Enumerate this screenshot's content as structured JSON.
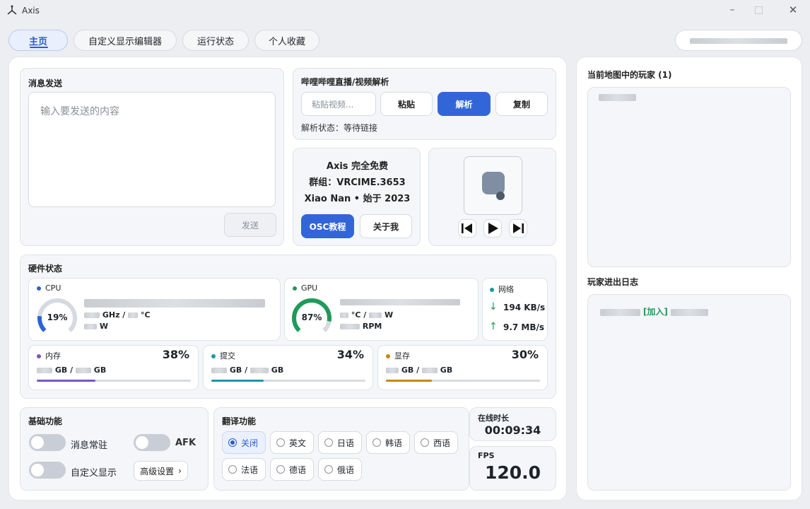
{
  "window": {
    "title": "Axis"
  },
  "tabs": [
    {
      "label": "主页"
    },
    {
      "label": "自定义显示编辑器"
    },
    {
      "label": "运行状态"
    },
    {
      "label": "个人收藏"
    }
  ],
  "message": {
    "title": "消息发送",
    "placeholder": "输入要发送的内容",
    "send": "发送"
  },
  "bili": {
    "title": "哔哩哔哩直播/视频解析",
    "placeholder": "粘贴视频...",
    "paste": "粘贴",
    "parse": "解析",
    "copy": "复制",
    "status": "解析状态：等待链接"
  },
  "about": {
    "line1": "Axis 完全免费",
    "line2": "群组：VRCIME.3653",
    "line3": "Xiao Nan • 始于 2023",
    "osc": "OSC教程",
    "about_me": "关于我"
  },
  "hardware": {
    "title": "硬件状态",
    "cpu": {
      "label": "CPU",
      "percent": "19%",
      "value": 19,
      "unit1": "GHz /",
      "unit2": "°C",
      "unit3": "W",
      "color": "#2f63d3"
    },
    "gpu": {
      "label": "GPU",
      "percent": "87%",
      "value": 87,
      "unit1": "°C /",
      "unit2": "W",
      "unit3": "RPM",
      "color": "#1f9a5a"
    },
    "net": {
      "label": "网络",
      "down_icon": "↓",
      "down": "194 KB/s",
      "up_icon": "↑",
      "up": "9.7 MB/s"
    },
    "mem": {
      "label": "内存",
      "percent": "38%",
      "value": 38,
      "gb1": "GB /",
      "gb2": "GB",
      "color": "#7a55c8"
    },
    "commit": {
      "label": "提交",
      "percent": "34%",
      "value": 34,
      "gb1": "GB /",
      "gb2": "GB",
      "color": "#1a98a8"
    },
    "vram": {
      "label": "显存",
      "percent": "30%",
      "value": 30,
      "gb1": "GB /",
      "gb2": "GB",
      "color": "#c98612"
    }
  },
  "basic": {
    "title": "基础功能",
    "msg": "消息常驻",
    "afk": "AFK",
    "custom": "自定义显示",
    "advanced": "高级设置"
  },
  "translate": {
    "title": "翻译功能",
    "options": [
      "关闭",
      "英文",
      "日语",
      "韩语",
      "西语",
      "法语",
      "德语",
      "俄语"
    ],
    "selected": "关闭"
  },
  "online": {
    "label": "在线时长",
    "value": "00:09:34"
  },
  "fps": {
    "label": "FPS",
    "value": "120.0"
  },
  "players": {
    "title": "当前地图中的玩家 (1)",
    "log_title": "玩家进出日志",
    "join": "[加入]"
  }
}
